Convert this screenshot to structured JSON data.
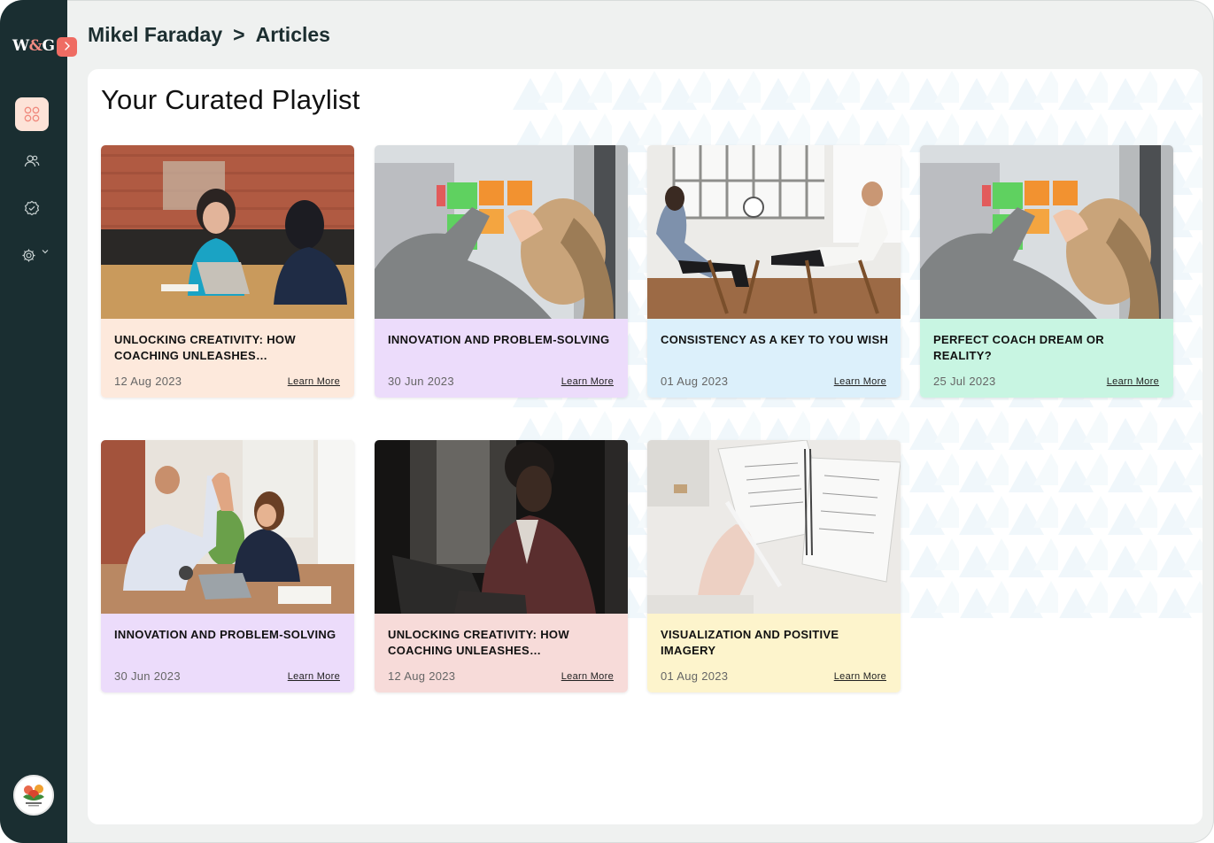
{
  "app": {
    "logo_text_left": "W",
    "logo_amp": "&",
    "logo_text_right": "G",
    "collapse_icon": "chevron-right-icon"
  },
  "sidebar": {
    "items": [
      {
        "name": "dashboard",
        "icon": "grid-icon",
        "active": true
      },
      {
        "name": "people",
        "icon": "users-icon",
        "active": false
      },
      {
        "name": "verified",
        "icon": "badge-check-icon",
        "active": false
      },
      {
        "name": "settings",
        "icon": "gear-icon",
        "active": false,
        "has_dropdown": true
      }
    ],
    "accent_color": "#f08a7e",
    "background_color": "#1a2e31"
  },
  "breadcrumb": {
    "parent": "Mikel Faraday",
    "separator": ">",
    "current": "Articles"
  },
  "page_title": "Your Curated Playlist",
  "cards": [
    {
      "title": "Unlocking creativity: How coaching unleashes innovation…",
      "date": "12 Aug 2023",
      "link": "Learn More",
      "bg": "#fde9dc",
      "image": "meeting-at-brick-wall"
    },
    {
      "title": "Innovation and problem-solving",
      "date": "30 Jun 2023",
      "link": "Learn More",
      "bg": "#ecdcfb",
      "image": "sticky-notes-window"
    },
    {
      "title": "Consistency as a key to you wish",
      "date": "01 Aug 2023",
      "link": "Learn More",
      "bg": "#dcf0fb",
      "image": "therapy-session"
    },
    {
      "title": "Perfect coach dream or reality?",
      "date": "25 Jul 2023",
      "link": "Learn More",
      "bg": "#c8f5e2",
      "image": "sticky-notes-window"
    },
    {
      "title": "Innovation and problem-solving",
      "date": "30 Jun 2023",
      "link": "Learn More",
      "bg": "#ecdcfb",
      "image": "high-five-office"
    },
    {
      "title": "Unlocking creativity: How coaching unleashes innovation…",
      "date": "12 Aug 2023",
      "link": "Learn More",
      "bg": "#f7dbd9",
      "image": "woman-laptop-dark"
    },
    {
      "title": "Visualization and positive imagery",
      "date": "01 Aug 2023",
      "link": "Learn More",
      "bg": "#fdf4cc",
      "image": "notebook-planner"
    }
  ]
}
